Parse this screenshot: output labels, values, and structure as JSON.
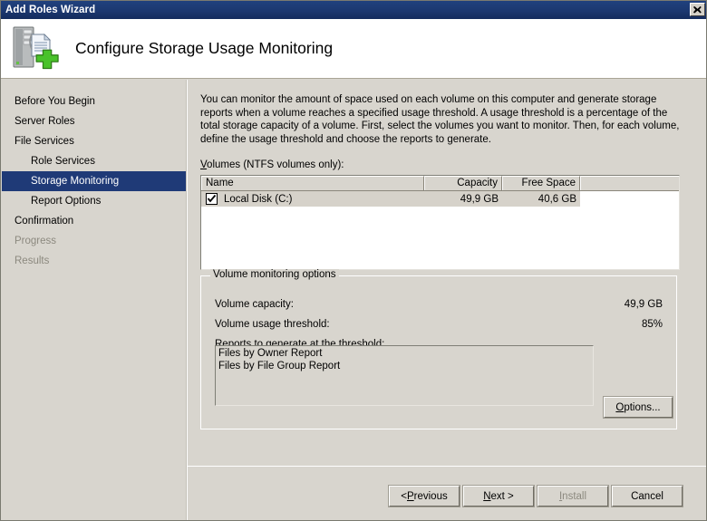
{
  "window": {
    "title": "Add Roles Wizard",
    "close_icon": "close-icon"
  },
  "header": {
    "title": "Configure Storage Usage Monitoring",
    "icon": "server-with-document-and-plus-icon"
  },
  "sidebar": {
    "items": [
      {
        "label": "Before You Begin",
        "level": 0,
        "state": "normal"
      },
      {
        "label": "Server Roles",
        "level": 0,
        "state": "normal"
      },
      {
        "label": "File Services",
        "level": 0,
        "state": "normal"
      },
      {
        "label": "Role Services",
        "level": 1,
        "state": "normal"
      },
      {
        "label": "Storage Monitoring",
        "level": 1,
        "state": "selected"
      },
      {
        "label": "Report Options",
        "level": 1,
        "state": "normal"
      },
      {
        "label": "Confirmation",
        "level": 0,
        "state": "normal"
      },
      {
        "label": "Progress",
        "level": 0,
        "state": "disabled"
      },
      {
        "label": "Results",
        "level": 0,
        "state": "disabled"
      }
    ]
  },
  "main": {
    "intro": "You can monitor the amount of space used on each volume on this computer and generate storage reports when a volume reaches a specified usage threshold.  A usage threshold is a percentage of the total storage capacity of a volume. First, select the volumes you want to monitor.  Then, for each volume, define the usage threshold and choose the reports to generate.",
    "volumes_label_accel": "V",
    "volumes_label_rest": "olumes (NTFS volumes only):",
    "volumes_table": {
      "columns": [
        "Name",
        "Capacity",
        "Free Space"
      ],
      "rows": [
        {
          "checked": true,
          "name": "Local Disk (C:)",
          "capacity": "49,9 GB",
          "free_space": "40,6 GB",
          "selected": true
        }
      ]
    },
    "groupbox": {
      "legend": "Volume monitoring options",
      "capacity_label": "Volume capacity:",
      "capacity_value": "49,9 GB",
      "threshold_label": "Volume usage threshold:",
      "threshold_value": "85%",
      "reports_label": "Reports to generate at the threshold:",
      "reports": [
        "Files by Owner Report",
        "Files by File Group Report"
      ],
      "options_button_accel": "O",
      "options_button_rest": "ptions..."
    }
  },
  "footer": {
    "buttons": [
      {
        "pre": "< ",
        "accel": "P",
        "post": "revious",
        "disabled": false,
        "name": "previous-button"
      },
      {
        "pre": "",
        "accel": "N",
        "post": "ext >",
        "disabled": false,
        "name": "next-button"
      },
      {
        "pre": "",
        "accel": "I",
        "post": "nstall",
        "disabled": true,
        "name": "install-button"
      },
      {
        "pre": "",
        "accel": "",
        "post": "Cancel",
        "disabled": false,
        "name": "cancel-button"
      }
    ]
  },
  "colors": {
    "titlebar": "#1f3a77",
    "selection": "#1f3a77",
    "dialog_face": "#d8d5ce",
    "row_selected": "#d6d2ca",
    "disabled_text": "#8c897f"
  }
}
